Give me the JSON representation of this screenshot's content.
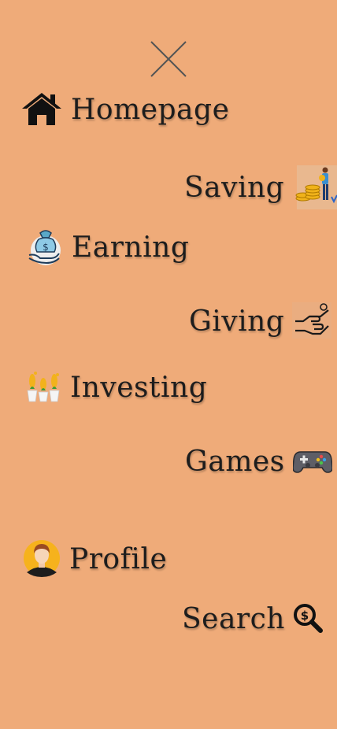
{
  "menu": {
    "close_icon": "close-icon",
    "items": [
      {
        "label": "Homepage",
        "icon": "home-icon"
      },
      {
        "label": "Saving",
        "icon": "saving-coins-icon"
      },
      {
        "label": "Earning",
        "icon": "money-bag-hand-icon"
      },
      {
        "label": "Giving",
        "icon": "giving-hands-icon"
      },
      {
        "label": "Investing",
        "icon": "investing-plants-icon"
      },
      {
        "label": "Games",
        "icon": "gamepad-icon"
      },
      {
        "label": "Profile",
        "icon": "avatar-icon"
      },
      {
        "label": "Search",
        "icon": "dollar-search-icon"
      }
    ]
  },
  "colors": {
    "background": "#EFAB79",
    "text": "#1d1d1d",
    "close_stroke": "#555555"
  }
}
